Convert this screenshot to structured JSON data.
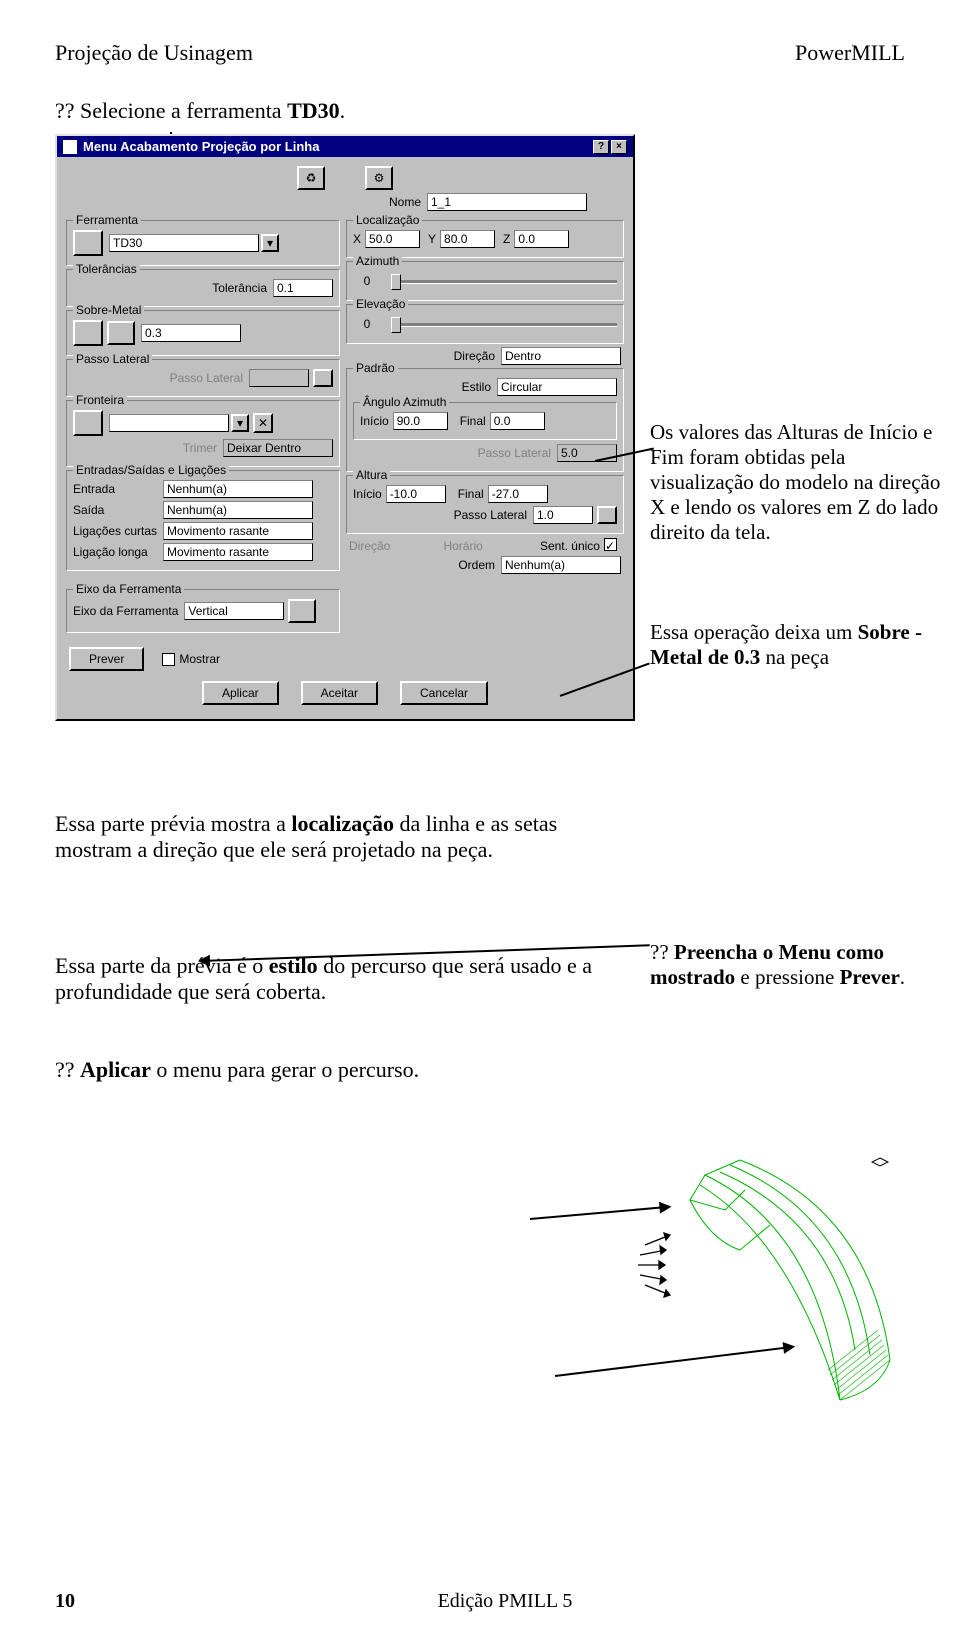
{
  "header": {
    "left": "Projeção de Usinagem",
    "right": "PowerMILL"
  },
  "step1": {
    "prefix": "?? Selecione a ferramenta ",
    "bold": "TD30",
    "suffix": "."
  },
  "dialog": {
    "title": "Menu Acabamento Projeção por Linha",
    "name_label": "Nome",
    "name_value": "1_1",
    "ferramenta": {
      "legend": "Ferramenta",
      "value": "TD30"
    },
    "tolerancias": {
      "legend": "Tolerâncias",
      "label": "Tolerância",
      "value": "0.1"
    },
    "sobremetal": {
      "legend": "Sobre-Metal",
      "value": "0.3"
    },
    "passolateral_left": {
      "legend": "Passo Lateral",
      "label": "Passo Lateral"
    },
    "fronteira": {
      "legend": "Fronteira"
    },
    "trimer": {
      "label": "Trimer",
      "value": "Deixar Dentro"
    },
    "entradas": {
      "legend": "Entradas/Saídas e Ligações",
      "entrada": {
        "label": "Entrada",
        "value": "Nenhum(a)"
      },
      "saida": {
        "label": "Saída",
        "value": "Nenhum(a)"
      },
      "lig_curtas": {
        "label": "Ligações curtas",
        "value": "Movimento rasante"
      },
      "lig_longa": {
        "label": "Ligação longa",
        "value": "Movimento rasante"
      }
    },
    "eixo": {
      "legend": "Eixo da Ferramenta",
      "label": "Eixo da Ferramenta",
      "value": "Vertical"
    },
    "localizacao": {
      "legend": "Localização",
      "x": "50.0",
      "y": "80.0",
      "z": "0.0",
      "x_label": "X",
      "y_label": "Y",
      "z_label": "Z"
    },
    "azimuth": {
      "legend": "Azimuth",
      "zero": "0"
    },
    "elevacao": {
      "legend": "Elevação",
      "zero": "0"
    },
    "direcao_label": "Direção",
    "direcao_value": "Dentro",
    "padrao": {
      "legend": "Padrão",
      "estilo": {
        "label": "Estilo",
        "value": "Circular"
      },
      "angulo": {
        "legend": "Ângulo Azimuth",
        "inicio_label": "Início",
        "inicio": "90.0",
        "final_label": "Final",
        "final": "0.0"
      },
      "passo_lateral_val": "5.0",
      "passo_lateral_label": "Passo Lateral"
    },
    "altura": {
      "legend": "Altura",
      "inicio_label": "Início",
      "inicio": "-10.0",
      "final_label": "Final",
      "final": "-27.0",
      "passo_label": "Passo Lateral",
      "passo": "1.0"
    },
    "direcao2": {
      "label": "Direção"
    },
    "sent_unico": {
      "label": "Sent. único"
    },
    "horario": {
      "label": "Horário"
    },
    "ordem": {
      "label": "Ordem",
      "value": "Nenhum(a)"
    },
    "prever": "Prever",
    "mostrar": "Mostrar",
    "aplicar": "Aplicar",
    "aceitar": "Aceitar",
    "cancelar": "Cancelar",
    "help": "?",
    "close": "×"
  },
  "anno1": {
    "text1": "Os valores das Alturas de Início e Fim foram obtidas pela visualização do modelo na direção X e lendo os valores em Z do lado direito da tela."
  },
  "anno2": {
    "text1": "Essa operação deixa um ",
    "bold": "Sobre - Metal de 0.3",
    "text2": " na peça"
  },
  "anno3": {
    "prefix": "?? ",
    "bold1": "Preencha o Menu como mostrado",
    "mid": " e pressione ",
    "bold2": "Prever",
    "suffix": "."
  },
  "para1": {
    "t1": "Essa parte prévia mostra a ",
    "b1": "localização",
    "t2": " da linha e as setas mostram a direção que ele será projetado na peça."
  },
  "para2": {
    "t1": "Essa parte da prévia é o ",
    "b1": "estilo",
    "t2": " do percurso que será usado e a profundidade que será coberta."
  },
  "step_bottom": {
    "prefix": "?? ",
    "bold": "Aplicar",
    "suffix": " o menu para gerar o percurso."
  },
  "footer": {
    "page": "10",
    "edition": "Edição PMILL 5"
  }
}
